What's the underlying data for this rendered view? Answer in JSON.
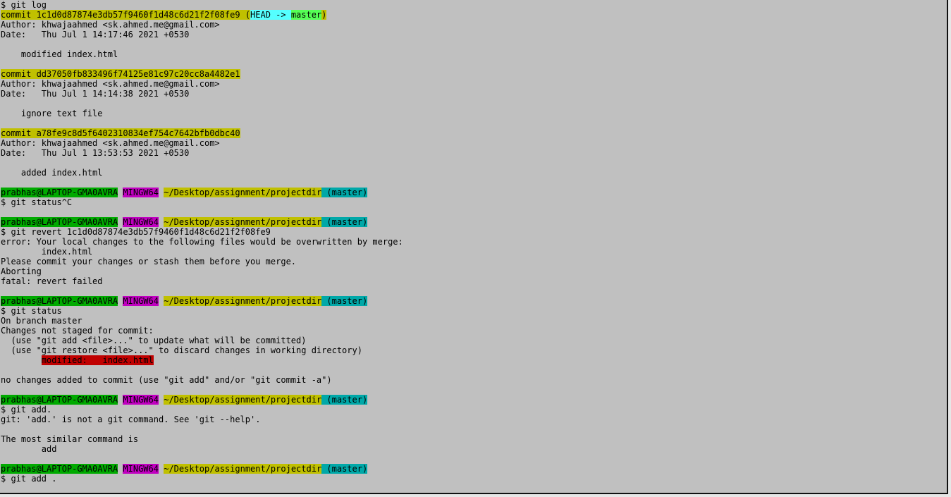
{
  "terminal": {
    "colors": {
      "background": "#c0c0c0",
      "text": "#000000",
      "commit_hl": "#c0c000",
      "head_hl": "#55ffff",
      "branch_hl": "#55ff55",
      "user_hl": "#00aa00",
      "mingw_hl": "#c000c0",
      "path_hl": "#c0c000",
      "branch_prompt_hl": "#00a8a8",
      "modified_hl": "#c00000"
    },
    "lines": [
      {
        "segments": [
          {
            "text": "$ git log"
          }
        ]
      },
      {
        "segments": [
          {
            "text": "commit 1c1d0d87874e3db57f9460f1d48c6d21f2f08fe9 (",
            "bg": "commit_hl"
          },
          {
            "text": "HEAD -> ",
            "bg": "head_hl"
          },
          {
            "text": "master",
            "bg": "branch_hl"
          },
          {
            "text": ")",
            "bg": "commit_hl"
          }
        ]
      },
      {
        "segments": [
          {
            "text": "Author: khwajaahmed <sk.ahmed.me@gmail.com>"
          }
        ]
      },
      {
        "segments": [
          {
            "text": "Date:   Thu Jul 1 14:17:46 2021 +0530"
          }
        ]
      },
      {
        "segments": [
          {
            "text": ""
          }
        ]
      },
      {
        "segments": [
          {
            "text": "    modified index.html"
          }
        ]
      },
      {
        "segments": [
          {
            "text": ""
          }
        ]
      },
      {
        "segments": [
          {
            "text": "commit dd37050fb833496f74125e81c97c20cc8a4482e1",
            "bg": "commit_hl"
          }
        ]
      },
      {
        "segments": [
          {
            "text": "Author: khwajaahmed <sk.ahmed.me@gmail.com>"
          }
        ]
      },
      {
        "segments": [
          {
            "text": "Date:   Thu Jul 1 14:14:38 2021 +0530"
          }
        ]
      },
      {
        "segments": [
          {
            "text": ""
          }
        ]
      },
      {
        "segments": [
          {
            "text": "    ignore text file"
          }
        ]
      },
      {
        "segments": [
          {
            "text": ""
          }
        ]
      },
      {
        "segments": [
          {
            "text": "commit a78fe9c8d5f6402310834ef754c7642bfb0dbc40",
            "bg": "commit_hl"
          }
        ]
      },
      {
        "segments": [
          {
            "text": "Author: khwajaahmed <sk.ahmed.me@gmail.com>"
          }
        ]
      },
      {
        "segments": [
          {
            "text": "Date:   Thu Jul 1 13:53:53 2021 +0530"
          }
        ]
      },
      {
        "segments": [
          {
            "text": ""
          }
        ]
      },
      {
        "segments": [
          {
            "text": "    added index.html"
          }
        ]
      },
      {
        "segments": [
          {
            "text": ""
          }
        ]
      },
      {
        "segments": [
          {
            "text": "prabhas@LAPTOP-GMA0AVRA",
            "bg": "user_hl"
          },
          {
            "text": " "
          },
          {
            "text": "MINGW64",
            "bg": "mingw_hl"
          },
          {
            "text": " "
          },
          {
            "text": "~/Desktop/assignment/projectdir",
            "bg": "path_hl"
          },
          {
            "text": " (master)",
            "bg": "branch_prompt_hl"
          }
        ]
      },
      {
        "segments": [
          {
            "text": "$ git status^C"
          }
        ]
      },
      {
        "segments": [
          {
            "text": ""
          }
        ]
      },
      {
        "segments": [
          {
            "text": "prabhas@LAPTOP-GMA0AVRA",
            "bg": "user_hl"
          },
          {
            "text": " "
          },
          {
            "text": "MINGW64",
            "bg": "mingw_hl"
          },
          {
            "text": " "
          },
          {
            "text": "~/Desktop/assignment/projectdir",
            "bg": "path_hl"
          },
          {
            "text": " (master)",
            "bg": "branch_prompt_hl"
          }
        ]
      },
      {
        "segments": [
          {
            "text": "$ git revert 1c1d0d87874e3db57f9460f1d48c6d21f2f08fe9"
          }
        ]
      },
      {
        "segments": [
          {
            "text": "error: Your local changes to the following files would be overwritten by merge:"
          }
        ]
      },
      {
        "segments": [
          {
            "text": "        index.html"
          }
        ]
      },
      {
        "segments": [
          {
            "text": "Please commit your changes or stash them before you merge."
          }
        ]
      },
      {
        "segments": [
          {
            "text": "Aborting"
          }
        ]
      },
      {
        "segments": [
          {
            "text": "fatal: revert failed"
          }
        ]
      },
      {
        "segments": [
          {
            "text": ""
          }
        ]
      },
      {
        "segments": [
          {
            "text": "prabhas@LAPTOP-GMA0AVRA",
            "bg": "user_hl"
          },
          {
            "text": " "
          },
          {
            "text": "MINGW64",
            "bg": "mingw_hl"
          },
          {
            "text": " "
          },
          {
            "text": "~/Desktop/assignment/projectdir",
            "bg": "path_hl"
          },
          {
            "text": " (master)",
            "bg": "branch_prompt_hl"
          }
        ]
      },
      {
        "segments": [
          {
            "text": "$ git status"
          }
        ]
      },
      {
        "segments": [
          {
            "text": "On branch master"
          }
        ]
      },
      {
        "segments": [
          {
            "text": "Changes not staged for commit:"
          }
        ]
      },
      {
        "segments": [
          {
            "text": "  (use \"git add <file>...\" to update what will be committed)"
          }
        ]
      },
      {
        "segments": [
          {
            "text": "  (use \"git restore <file>...\" to discard changes in working directory)"
          }
        ]
      },
      {
        "segments": [
          {
            "text": "        "
          },
          {
            "text": "modified:   index.html",
            "bg": "modified_hl"
          }
        ]
      },
      {
        "segments": [
          {
            "text": ""
          }
        ]
      },
      {
        "segments": [
          {
            "text": "no changes added to commit (use \"git add\" and/or \"git commit -a\")"
          }
        ]
      },
      {
        "segments": [
          {
            "text": ""
          }
        ]
      },
      {
        "segments": [
          {
            "text": "prabhas@LAPTOP-GMA0AVRA",
            "bg": "user_hl"
          },
          {
            "text": " "
          },
          {
            "text": "MINGW64",
            "bg": "mingw_hl"
          },
          {
            "text": " "
          },
          {
            "text": "~/Desktop/assignment/projectdir",
            "bg": "path_hl"
          },
          {
            "text": " (master)",
            "bg": "branch_prompt_hl"
          }
        ]
      },
      {
        "segments": [
          {
            "text": "$ git add."
          }
        ]
      },
      {
        "segments": [
          {
            "text": "git: 'add.' is not a git command. See 'git --help'."
          }
        ]
      },
      {
        "segments": [
          {
            "text": ""
          }
        ]
      },
      {
        "segments": [
          {
            "text": "The most similar command is"
          }
        ]
      },
      {
        "segments": [
          {
            "text": "        add"
          }
        ]
      },
      {
        "segments": [
          {
            "text": ""
          }
        ]
      },
      {
        "segments": [
          {
            "text": "prabhas@LAPTOP-GMA0AVRA",
            "bg": "user_hl"
          },
          {
            "text": " "
          },
          {
            "text": "MINGW64",
            "bg": "mingw_hl"
          },
          {
            "text": " "
          },
          {
            "text": "~/Desktop/assignment/projectdir",
            "bg": "path_hl"
          },
          {
            "text": " (master)",
            "bg": "branch_prompt_hl"
          }
        ]
      },
      {
        "segments": [
          {
            "text": "$ git add ."
          }
        ]
      }
    ]
  }
}
